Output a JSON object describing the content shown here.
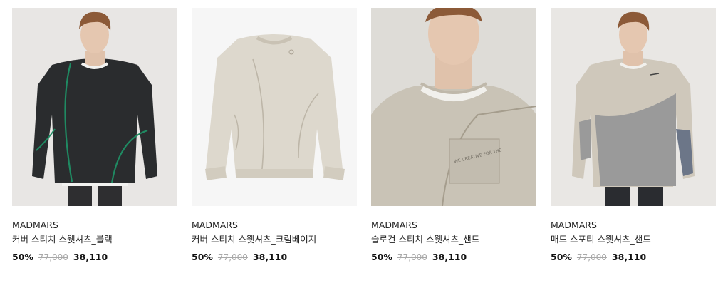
{
  "products": [
    {
      "brand": "MADMARS",
      "name": "커버 스티치 스웻셔츠_블랙",
      "discount": "50%",
      "original_price": "77,000",
      "sale_price": "38,110",
      "image": "model-black-sweatshirt-photo",
      "colors": {
        "bg": "#e8e6e4",
        "garment": "#2a2c2e",
        "stitch": "#1f8a62"
      }
    },
    {
      "brand": "MADMARS",
      "name": "커버 스티치 스웻셔츠_크림베이지",
      "discount": "50%",
      "original_price": "77,000",
      "sale_price": "38,110",
      "image": "flat-cream-beige-sweatshirt-photo",
      "colors": {
        "bg": "#f6f6f6",
        "garment": "#ddd8cd",
        "stitch": "#bdb6a8"
      }
    },
    {
      "brand": "MADMARS",
      "name": "슬로건 스티치 스웻셔츠_샌드",
      "discount": "50%",
      "original_price": "77,000",
      "sale_price": "38,110",
      "image": "closeup-sand-sweatshirt-photo",
      "colors": {
        "bg": "#dedcd7",
        "garment": "#c9c3b6",
        "stitch": "#a59d8d"
      }
    },
    {
      "brand": "MADMARS",
      "name": "매드 스포티 스웻셔츠_샌드",
      "discount": "50%",
      "original_price": "77,000",
      "sale_price": "38,110",
      "image": "model-sand-sporty-sweatshirt-photo",
      "colors": {
        "bg": "#e9e7e4",
        "garment": "#cfc8bb",
        "stitch": "#9a9a9a"
      }
    }
  ]
}
